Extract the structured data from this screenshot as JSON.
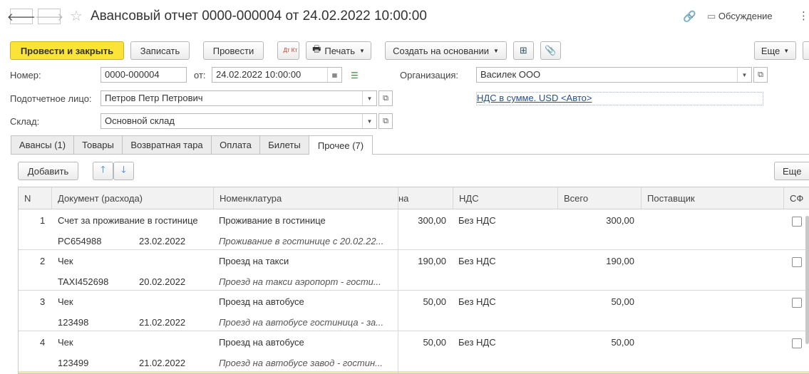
{
  "window": {
    "title": "Авансовый отчет 0000-000004 от 24.02.2022 10:00:00",
    "discussion_label": "Обсуждение"
  },
  "toolbar": {
    "post_close_label": "Провести и закрыть",
    "save_label": "Записать",
    "post_label": "Провести",
    "dtkt_label": "Дт Кт",
    "print_label": "Печать",
    "create_based_label": "Создать на основании",
    "more_label": "Еще"
  },
  "form": {
    "number_label": "Номер:",
    "number_value": "0000-000004",
    "date_label": "от:",
    "date_value": "24.02.2022 10:00:00",
    "organization_label": "Организация:",
    "organization_value": "Василек ООО",
    "person_label": "Подотчетное лицо:",
    "person_value": "Петров Петр Петрович",
    "vat_link": "НДС в сумме. USD <Авто>",
    "warehouse_label": "Склад:",
    "warehouse_value": "Основной склад"
  },
  "tabs": [
    {
      "label": "Авансы (1)"
    },
    {
      "label": "Товары"
    },
    {
      "label": "Возвратная тара"
    },
    {
      "label": "Оплата"
    },
    {
      "label": "Билеты"
    },
    {
      "label": "Прочее (7)"
    }
  ],
  "table_toolbar": {
    "add_label": "Добавить",
    "more_label": "Еще"
  },
  "table": {
    "columns": [
      "N",
      "Документ (расхода)",
      "Номенклатура",
      "на",
      "НДС",
      "Всего",
      "Поставщик",
      "СФ"
    ],
    "rows": [
      {
        "n": "1",
        "doc": "Счет за проживание в гостинице",
        "doc_num": "PC654988",
        "doc_date": "23.02.2022",
        "item": "Проживание в гостинице",
        "item_desc": "Проживание в гостинице с 20.02.22...",
        "sum": "300,00",
        "vat": "Без НДС",
        "total": "300,00"
      },
      {
        "n": "2",
        "doc": "Чек",
        "doc_num": "TAXI452698",
        "doc_date": "20.02.2022",
        "item": "Проезд на такси",
        "item_desc": "Проезд на такси аэропорт - гости...",
        "sum": "190,00",
        "vat": "Без НДС",
        "total": "190,00"
      },
      {
        "n": "3",
        "doc": "Чек",
        "doc_num": "123498",
        "doc_date": "21.02.2022",
        "item": "Проезд на автобусе",
        "item_desc": "Проезд на автобусе гостиница - за...",
        "sum": "50,00",
        "vat": "Без НДС",
        "total": "50,00"
      },
      {
        "n": "4",
        "doc": "Чек",
        "doc_num": "123499",
        "doc_date": "21.02.2022",
        "item": "Проезд на автобусе",
        "item_desc": "Проезд на автобусе завод - гостин...",
        "sum": "50,00",
        "vat": "Без НДС",
        "total": "50,00"
      }
    ]
  },
  "colors": {
    "primary_button": "#fbe337",
    "link": "#2a4f8f"
  }
}
